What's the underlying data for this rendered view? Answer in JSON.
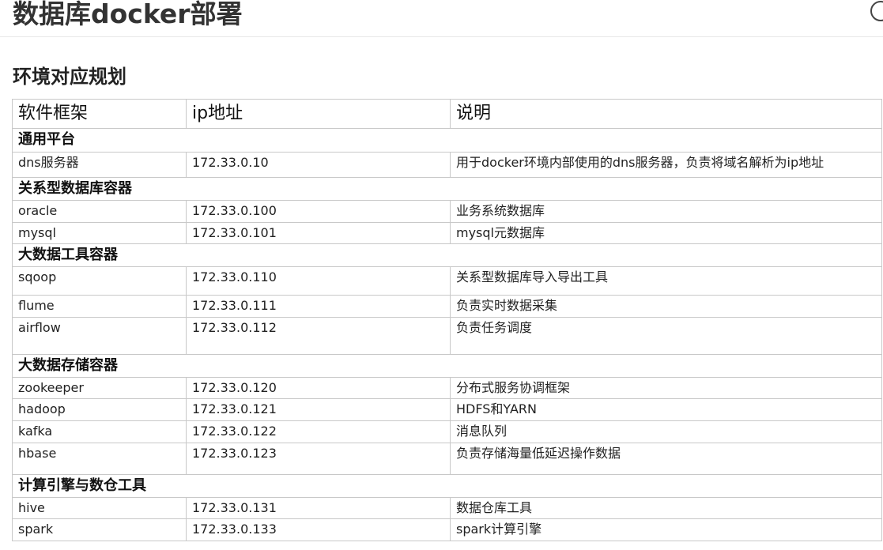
{
  "page": {
    "title": "数据库docker部署",
    "section_title": "环境对应规划"
  },
  "table": {
    "headers": [
      "软件框架",
      "ip地址",
      "说明"
    ],
    "groups": [
      {
        "name": "通用平台",
        "rows": [
          {
            "software": "dns服务器",
            "ip": "172.33.0.10",
            "desc": "用于docker环境内部使用的dns服务器，负责将域名解析为ip地址"
          }
        ]
      },
      {
        "name": "关系型数据库容器",
        "rows": [
          {
            "software": "oracle",
            "ip": "172.33.0.100",
            "desc": "业务系统数据库"
          },
          {
            "software": "mysql",
            "ip": "172.33.0.101",
            "desc": "mysql元数据库"
          }
        ]
      },
      {
        "name": "大数据工具容器",
        "rows": [
          {
            "software": "sqoop",
            "ip": "172.33.0.110",
            "desc": "关系型数据库导入导出工具"
          },
          {
            "software": "flume",
            "ip": "172.33.0.111",
            "desc": "负责实时数据采集"
          },
          {
            "software": "airflow",
            "ip": "172.33.0.112",
            "desc": "负责任务调度"
          }
        ]
      },
      {
        "name": "大数据存储容器",
        "rows": [
          {
            "software": "zookeeper",
            "ip": "172.33.0.120",
            "desc": "分布式服务协调框架"
          },
          {
            "software": "hadoop",
            "ip": "172.33.0.121",
            "desc": "HDFS和YARN"
          },
          {
            "software": "kafka",
            "ip": "172.33.0.122",
            "desc": "消息队列"
          },
          {
            "software": "hbase",
            "ip": "172.33.0.123",
            "desc": "负责存储海量低延迟操作数据"
          }
        ]
      },
      {
        "name": "计算引擎与数仓工具",
        "rows": [
          {
            "software": "hive",
            "ip": "172.33.0.131",
            "desc": "数据仓库工具"
          },
          {
            "software": "spark",
            "ip": "172.33.0.133",
            "desc": "spark计算引擎"
          }
        ]
      }
    ]
  }
}
